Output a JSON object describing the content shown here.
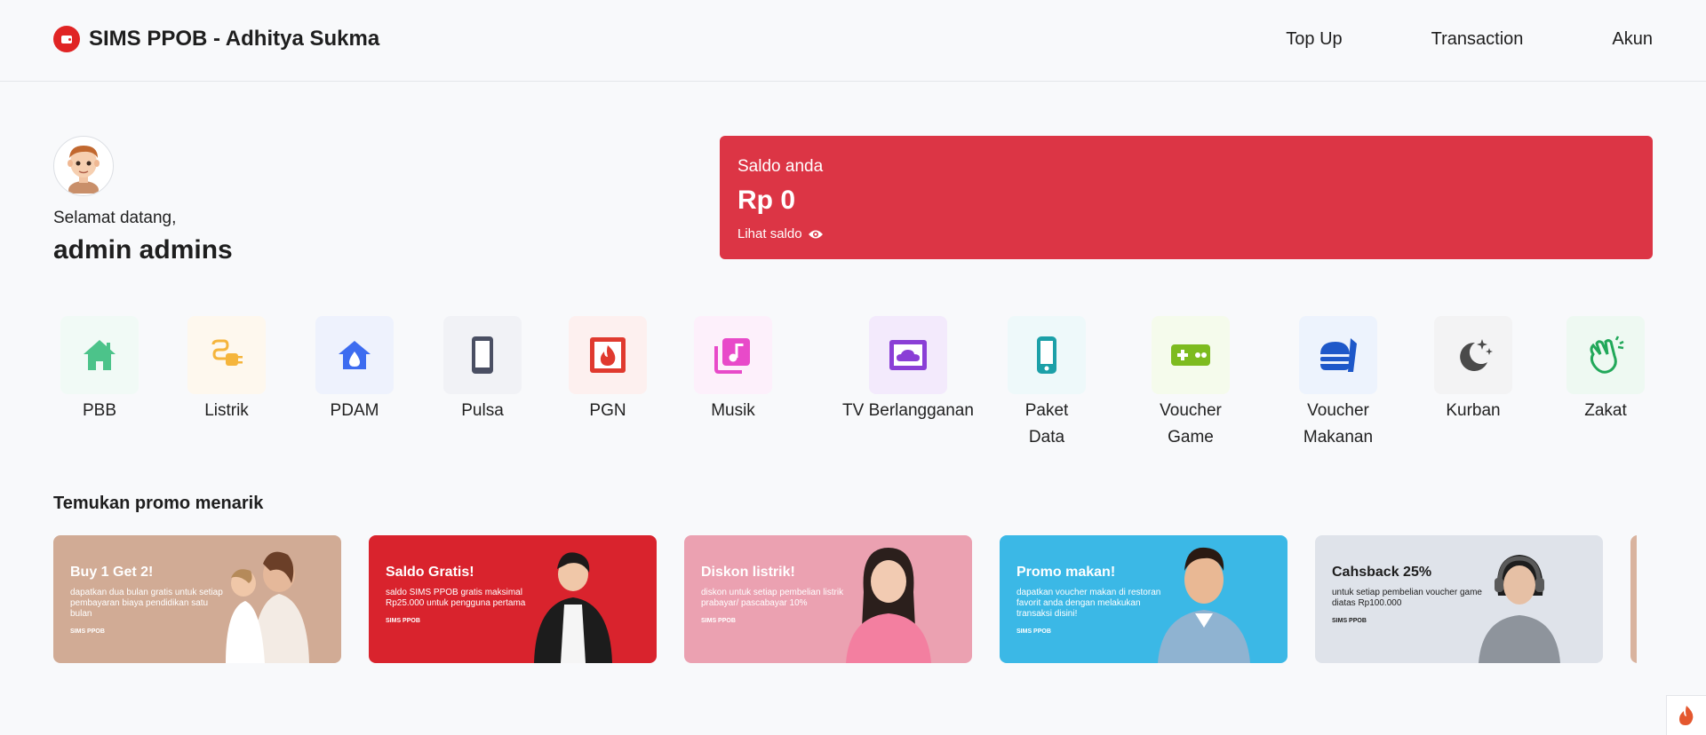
{
  "header": {
    "brand_title": "SIMS PPOB - Adhitya Sukma",
    "nav": [
      "Top Up",
      "Transaction",
      "Akun"
    ]
  },
  "profile": {
    "welcome": "Selamat datang,",
    "name": "admin admins"
  },
  "balance": {
    "label": "Saldo anda",
    "value": "Rp 0",
    "toggle_label": "Lihat saldo",
    "card_color": "#dc3545"
  },
  "services": [
    {
      "label": "PBB",
      "icon": "house-icon",
      "color": "#4cc38a",
      "bg": "#f1faf6"
    },
    {
      "label": "Listrik",
      "icon": "plug-icon",
      "color": "#f5b53c",
      "bg": "#fef8ee"
    },
    {
      "label": "PDAM",
      "icon": "water-house-icon",
      "color": "#3d6cf0",
      "bg": "#eef2fd"
    },
    {
      "label": "Pulsa",
      "icon": "phone-icon",
      "color": "#4a4f63",
      "bg": "#f1f2f6"
    },
    {
      "label": "PGN",
      "icon": "gas-flame-icon",
      "color": "#e03a2f",
      "bg": "#fdf0ef"
    },
    {
      "label": "Musik",
      "icon": "music-icon",
      "color": "#e84ac9",
      "bg": "#fdf0fb"
    },
    {
      "label": "TV Berlangganan",
      "icon": "tv-cloud-icon",
      "color": "#8a3fd6",
      "bg": "#f3eafc"
    },
    {
      "label": "Paket Data",
      "icon": "mobile-data-icon",
      "color": "#1ca0a8",
      "bg": "#eef9fa"
    },
    {
      "label": "Voucher Game",
      "icon": "gamepad-icon",
      "color": "#7dbb1f",
      "bg": "#f5fbec"
    },
    {
      "label": "Voucher Makanan",
      "icon": "burger-icon",
      "color": "#1e58c9",
      "bg": "#edf3fd"
    },
    {
      "label": "Kurban",
      "icon": "moon-star-icon",
      "color": "#4a4a4a",
      "bg": "#f3f3f4"
    },
    {
      "label": "Zakat",
      "icon": "hands-icon",
      "color": "#22a85a",
      "bg": "#eef9f2"
    }
  ],
  "promo": {
    "heading": "Temukan promo menarik",
    "cards": [
      {
        "title": "Buy 1 Get 2!",
        "desc": "dapatkan dua bulan gratis untuk setiap pembayaran biaya pendidikan satu bulan",
        "tag": "SIMS PPOB",
        "bg": "#d1ab95",
        "text_color": "#ffffff"
      },
      {
        "title": "Saldo Gratis!",
        "desc": "saldo SIMS PPOB gratis maksimal Rp25.000 untuk pengguna pertama",
        "tag": "SIMS PPOB",
        "bg": "#d9232d",
        "text_color": "#ffffff"
      },
      {
        "title": "Diskon listrik!",
        "desc": "diskon untuk setiap pembelian listrik prabayar/ pascabayar 10%",
        "tag": "SIMS PPOB",
        "bg": "#eba1b1",
        "text_color": "#ffffff"
      },
      {
        "title": "Promo makan!",
        "desc": "dapatkan voucher makan di restoran favorit anda dengan melakukan transaksi disini!",
        "tag": "SIMS PPOB",
        "bg": "#3bb8e6",
        "text_color": "#ffffff"
      },
      {
        "title": "Cahsback 25%",
        "desc": "untuk setiap pembelian voucher game diatas Rp100.000",
        "tag": "SIMS PPOB",
        "bg": "#dfe3ea",
        "text_color": "#1e1e1e"
      }
    ]
  }
}
